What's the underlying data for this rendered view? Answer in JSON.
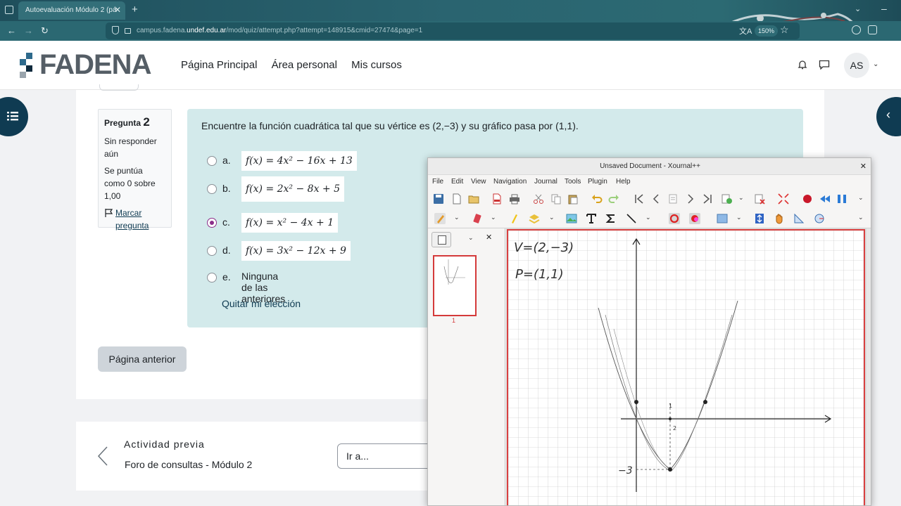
{
  "browser": {
    "tab_title": "Autoevaluación Módulo 2 (pá",
    "url_prefix": "campus.fadena.",
    "url_domain": "undef.edu.ar",
    "url_path": "/mod/quiz/attempt.php?attempt=148915&cmid=27474&page=1",
    "zoom": "150%"
  },
  "site": {
    "logo": "FADENA",
    "nav": [
      "Página Principal",
      "Área personal",
      "Mis cursos"
    ],
    "user_initials": "AS"
  },
  "question_info": {
    "label": "Pregunta",
    "number": "2",
    "state": "Sin responder aún",
    "grade": "Se puntúa como 0 sobre 1,00",
    "flag": "Marcar pregunta"
  },
  "question": {
    "text": "Encuentre la función cuadrática tal que su vértice es (2,−3) y su gráfico pasa por (1,1).",
    "options": [
      {
        "letter": "a.",
        "formula": "f(x) = 4x² − 16x + 13"
      },
      {
        "letter": "b.",
        "formula": "f(x) = 2x² − 8x + 5"
      },
      {
        "letter": "c.",
        "formula": "f(x) = x² − 4x + 1"
      },
      {
        "letter": "d.",
        "formula": "f(x) = 3x² − 12x + 9"
      },
      {
        "letter": "e.",
        "text": "Ninguna de las anteriores"
      }
    ],
    "selected": "c.",
    "clear_choice": "Quitar mi elección"
  },
  "buttons": {
    "previous_page": "Página anterior"
  },
  "activity": {
    "label": "Actividad previa",
    "link": "Foro de consultas - Módulo 2",
    "jump_placeholder": "Ir a..."
  },
  "xournal": {
    "title": "Unsaved Document - Xournal++",
    "menu": [
      "File",
      "Edit",
      "View",
      "Navigation",
      "Journal",
      "Tools",
      "Plugin",
      "Help"
    ],
    "page_number": "1",
    "notes": {
      "vertex": "V=(2,−3)",
      "point": "P=(1,1)",
      "tick_1": "1",
      "tick_2": "2",
      "tick_minus3": "−3"
    }
  },
  "colors": {
    "brand_dark": "#0f3b52",
    "question_bg": "#d3eaeb",
    "radio_selected": "#8c2e8a",
    "xournal_page_border": "#d94040"
  }
}
